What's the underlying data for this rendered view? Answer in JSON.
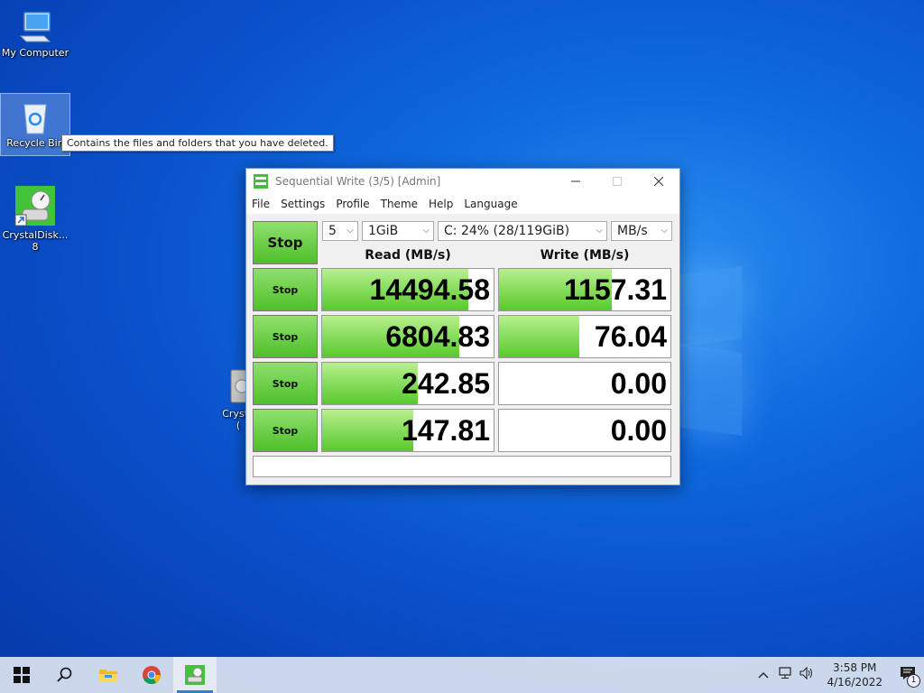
{
  "desktop": {
    "icons": [
      {
        "label": "My Computer"
      },
      {
        "label": "Recycle Bin"
      },
      {
        "label": "CrystalDisk...",
        "label2": "8"
      },
      {
        "label": "Crysta",
        "label2": "("
      }
    ],
    "tooltip": "Contains the files and folders that you have deleted."
  },
  "window": {
    "title": "Sequential Write (3/5) [Admin]",
    "menu": [
      "File",
      "Settings",
      "Profile",
      "Theme",
      "Help",
      "Language"
    ],
    "main_button": "Stop",
    "count": "5",
    "size": "1GiB",
    "drive": "C: 24% (28/119GiB)",
    "unit": "MB/s",
    "read_header": "Read (MB/s)",
    "write_header": "Write (MB/s)",
    "rows": [
      {
        "button": "Stop",
        "read": "14494.58",
        "read_fill": 0.85,
        "write": "1157.31",
        "write_fill": 0.66
      },
      {
        "button": "Stop",
        "read": "6804.83",
        "read_fill": 0.8,
        "write": "76.04",
        "write_fill": 0.47
      },
      {
        "button": "Stop",
        "read": "242.85",
        "read_fill": 0.56,
        "write": "0.00",
        "write_fill": 0
      },
      {
        "button": "Stop",
        "read": "147.81",
        "read_fill": 0.53,
        "write": "0.00",
        "write_fill": 0
      }
    ],
    "status": ""
  },
  "taskbar": {
    "icons": [
      "windows-start-icon",
      "search-icon",
      "file-explorer-icon",
      "chrome-icon",
      "crystaldiskmark-icon"
    ],
    "time": "3:58 PM",
    "date": "4/16/2022",
    "notification_count": "1"
  },
  "colors": {
    "accent": "#4fbf2a",
    "bar": "#58c92c",
    "desktop": "#0a4fc9"
  }
}
